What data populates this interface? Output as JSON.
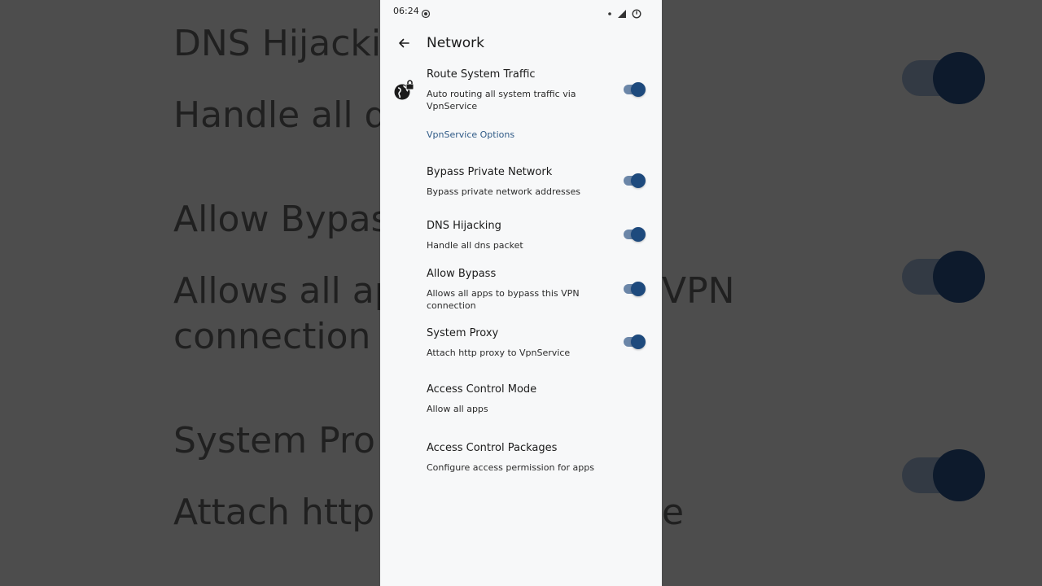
{
  "backdrop": {
    "texts": [
      {
        "id": "bg-dns",
        "text": "DNS Hijacki"
      },
      {
        "id": "bg-handle",
        "text": "Handle all dn"
      },
      {
        "id": "bg-allow",
        "text": "Allow Bypas"
      },
      {
        "id": "bg-allows",
        "text": "Allows all app"
      },
      {
        "id": "bg-vpn",
        "text": "VPN"
      },
      {
        "id": "bg-connection",
        "text": "connection"
      },
      {
        "id": "bg-sysproxy",
        "text": "System Pro"
      },
      {
        "id": "bg-attach",
        "text": "Attach http p"
      },
      {
        "id": "bg-e",
        "text": "e"
      }
    ]
  },
  "statusbar": {
    "time": "06:24"
  },
  "appbar": {
    "title": "Network"
  },
  "settings": {
    "route": {
      "title": "Route System Traffic",
      "subtitle": "Auto routing all system traffic via VpnService",
      "enabled": true
    },
    "section_label": "VpnService Options",
    "bypass_private": {
      "title": "Bypass Private Network",
      "subtitle": "Bypass private network addresses",
      "enabled": true
    },
    "dns_hijacking": {
      "title": "DNS Hijacking",
      "subtitle": "Handle all dns packet",
      "enabled": true
    },
    "allow_bypass": {
      "title": "Allow Bypass",
      "subtitle": "Allows all apps to bypass this VPN connection",
      "enabled": true
    },
    "system_proxy": {
      "title": "System Proxy",
      "subtitle": "Attach http proxy to VpnService",
      "enabled": true
    },
    "access_mode": {
      "title": "Access Control Mode",
      "subtitle": "Allow all apps"
    },
    "access_packages": {
      "title": "Access Control Packages",
      "subtitle": "Configure access permission for apps"
    }
  },
  "colors": {
    "accent": "#1e4a7d",
    "section_label": "#2f5a86",
    "background": "#f7f8f9"
  }
}
